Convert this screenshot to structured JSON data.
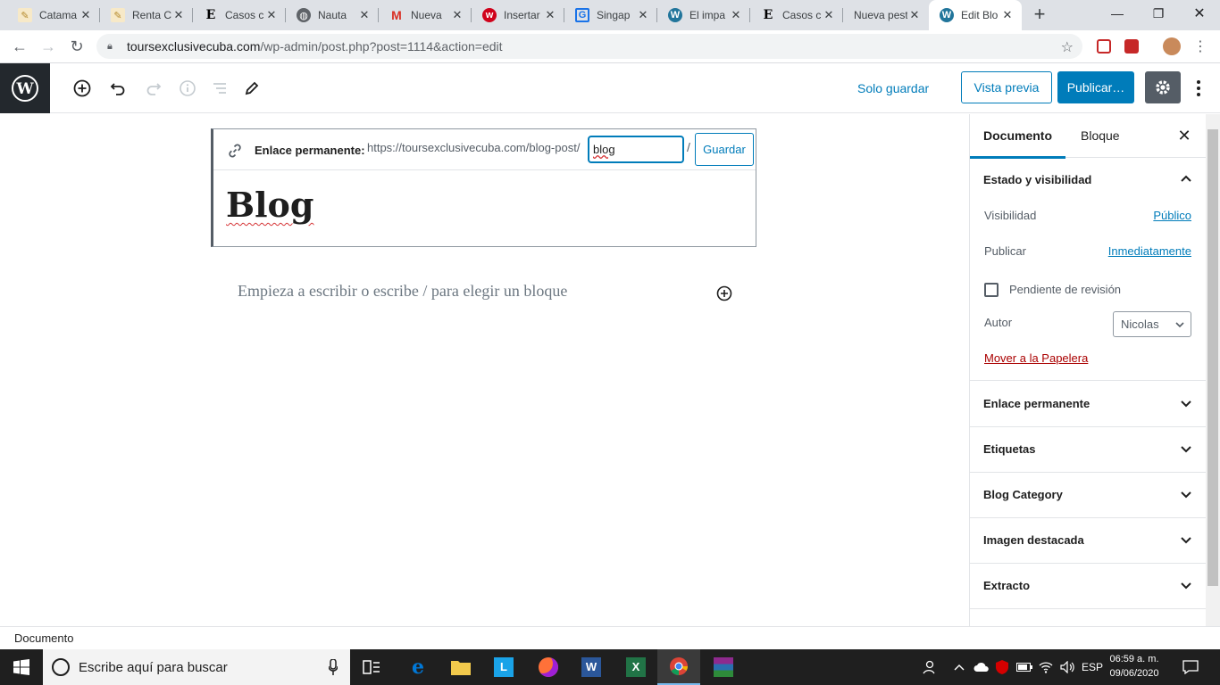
{
  "browser": {
    "tabs": [
      {
        "title": "Catama",
        "icon": "note-icon"
      },
      {
        "title": "Renta C",
        "icon": "note-icon"
      },
      {
        "title": "Casos c",
        "icon": "e-icon"
      },
      {
        "title": "Nauta",
        "icon": "globe-icon"
      },
      {
        "title": "Nueva",
        "icon": "gmail-icon"
      },
      {
        "title": "Insertar",
        "icon": "w-red-icon"
      },
      {
        "title": "Singap",
        "icon": "g-icon"
      },
      {
        "title": "El impa",
        "icon": "wordpress-icon"
      },
      {
        "title": "Casos c",
        "icon": "e-icon"
      },
      {
        "title": "Nueva pest",
        "icon": ""
      },
      {
        "title": "Edit Blo",
        "icon": "wordpress-icon"
      }
    ],
    "address_host": "toursexclusivecuba.com",
    "address_path": "/wp-admin/post.php?post=1114&action=edit"
  },
  "wp_toolbar": {
    "save_draft": "Solo guardar",
    "preview": "Vista previa",
    "publish": "Publicar…"
  },
  "permalink": {
    "label": "Enlace permanente:",
    "base_url": "https://toursexclusivecuba.com/blog-post/",
    "slug": "blog",
    "slash": "/",
    "save": "Guardar"
  },
  "post": {
    "title": "Blog",
    "placeholder": "Empieza a escribir o escribe / para elegir un bloque"
  },
  "sidebar": {
    "tab_document": "Documento",
    "tab_block": "Bloque",
    "status_panel": {
      "title": "Estado y visibilidad",
      "visibility_label": "Visibilidad",
      "visibility_value": "Público",
      "publish_label": "Publicar",
      "publish_value": "Inmediatamente",
      "pending_label": "Pendiente de revisión",
      "author_label": "Autor",
      "author_value": "Nicolas",
      "trash": "Mover a la Papelera"
    },
    "panels": [
      "Enlace permanente",
      "Etiquetas",
      "Blog Category",
      "Imagen destacada",
      "Extracto"
    ]
  },
  "footer": {
    "breadcrumb": "Documento"
  },
  "taskbar": {
    "search_placeholder": "Escribe aquí para buscar",
    "language": "ESP",
    "time": "06:59 a. m.",
    "date": "09/06/2020"
  },
  "colors": {
    "accent": "#007cba",
    "danger": "#a00",
    "wp_dark": "#23282d"
  }
}
